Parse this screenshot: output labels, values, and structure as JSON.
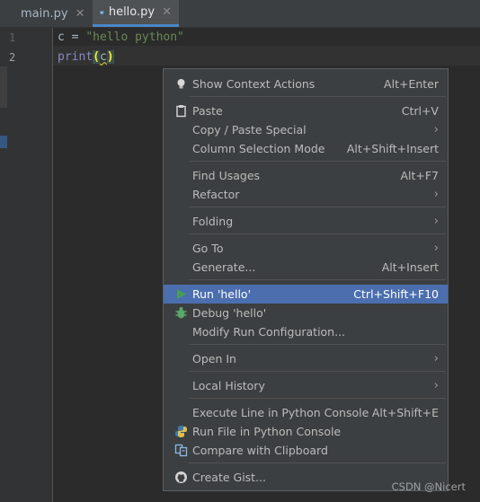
{
  "tabs": [
    {
      "label": "main.py",
      "active": false
    },
    {
      "label": "hello.py",
      "active": true
    }
  ],
  "editor": {
    "line_numbers": [
      "1",
      "2"
    ],
    "lines": [
      {
        "var": "c",
        "op": " = ",
        "string": "\"hello python\""
      },
      {
        "func": "print",
        "open": "(",
        "arg": "c",
        "close": ")"
      }
    ]
  },
  "context_menu": {
    "items": [
      {
        "label": "Show Context Actions",
        "mnemonic": "",
        "shortcut": "Alt+Enter",
        "submenu": false,
        "icon": "lightbulb-icon"
      },
      {
        "label": "Paste",
        "shortcut": "Ctrl+V",
        "submenu": false,
        "icon": "clipboard-icon"
      },
      {
        "label": "Copy / Paste Special",
        "shortcut": "",
        "submenu": true
      },
      {
        "label": "Column Selection Mode",
        "shortcut": "Alt+Shift+Insert",
        "submenu": false
      },
      {
        "label": "Find Usages",
        "shortcut": "Alt+F7",
        "submenu": false
      },
      {
        "label": "Refactor",
        "shortcut": "",
        "submenu": true
      },
      {
        "label": "Folding",
        "shortcut": "",
        "submenu": true
      },
      {
        "label": "Go To",
        "shortcut": "",
        "submenu": true
      },
      {
        "label": "Generate...",
        "shortcut": "Alt+Insert",
        "submenu": false
      },
      {
        "label": "Run 'hello'",
        "shortcut": "Ctrl+Shift+F10",
        "submenu": false,
        "icon": "run-icon",
        "selected": true
      },
      {
        "label": "Debug 'hello'",
        "shortcut": "",
        "submenu": false,
        "icon": "debug-bug-icon"
      },
      {
        "label": "Modify Run Configuration...",
        "shortcut": "",
        "submenu": false
      },
      {
        "label": "Open In",
        "shortcut": "",
        "submenu": true
      },
      {
        "label": "Local History",
        "shortcut": "",
        "submenu": true
      },
      {
        "label": "Execute Line in Python Console",
        "shortcut": "Alt+Shift+E",
        "submenu": false
      },
      {
        "label": "Run File in Python Console",
        "shortcut": "",
        "submenu": false,
        "icon": "python-icon"
      },
      {
        "label": "Compare with Clipboard",
        "shortcut": "",
        "submenu": false,
        "icon": "compare-icon"
      },
      {
        "label": "Create Gist...",
        "shortcut": "",
        "submenu": false,
        "icon": "github-icon"
      }
    ]
  },
  "watermark": "CSDN @Nicert",
  "colors": {
    "selection": "#4b6eaf",
    "menu_bg": "#3c3f41",
    "editor_bg": "#2b2b2b",
    "string": "#6a8759",
    "run_green": "#499c54"
  }
}
